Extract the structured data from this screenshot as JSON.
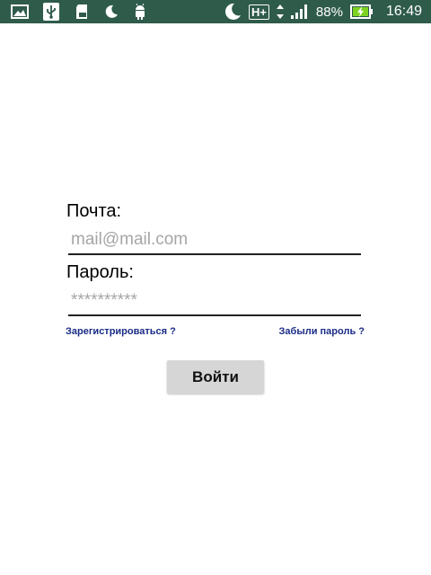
{
  "status_bar": {
    "left_icons": [
      "image-icon",
      "usb-icon",
      "sd-card-icon",
      "moon-icon",
      "android-icon"
    ],
    "right_icons": [
      "moon-icon",
      "network-type-icon",
      "data-arrows-icon",
      "signal-icon",
      "battery-charging-icon"
    ],
    "network_type": "H+",
    "battery": "88%",
    "time": "16:49"
  },
  "form": {
    "email_label": "Почта:",
    "email_placeholder": "mail@mail.com",
    "password_label": "Пароль:",
    "password_placeholder": "**********",
    "register_link": "Зарегистрироваться ?",
    "forgot_link": "Забыли пароль ?",
    "login_button": "Войти"
  },
  "colors": {
    "status_bar": "#2f5b4b",
    "link": "#1a2c86",
    "button": "#d6d6d6"
  }
}
